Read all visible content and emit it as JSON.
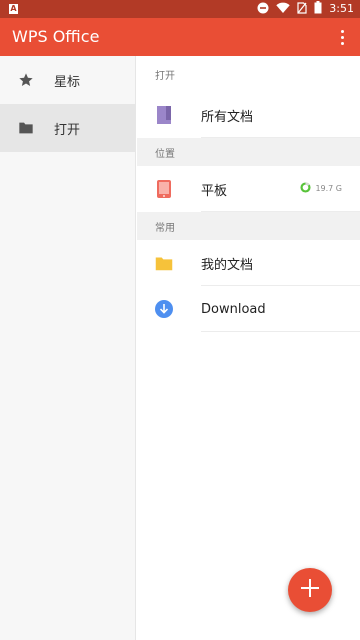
{
  "status_bar": {
    "left_icon_label": "A",
    "time": "3:51",
    "icons": [
      "do-not-disturb-icon",
      "wifi-icon",
      "no-sim-icon",
      "battery-icon"
    ]
  },
  "app_bar": {
    "title": "WPS Office",
    "overflow_icon": "more-vertical-icon"
  },
  "sidebar": {
    "items": [
      {
        "label": "星标",
        "icon": "star-icon",
        "active": false
      },
      {
        "label": "打开",
        "icon": "folder-icon",
        "active": true
      }
    ]
  },
  "main": {
    "sections": [
      {
        "header": "打开",
        "items": [
          {
            "label": "所有文档",
            "icon": "document-icon"
          }
        ]
      },
      {
        "header": "位置",
        "items": [
          {
            "label": "平板",
            "icon": "tablet-icon",
            "storage_text": "19.7 G"
          }
        ]
      },
      {
        "header": "常用",
        "items": [
          {
            "label": "我的文档",
            "icon": "folder-icon"
          },
          {
            "label": "Download",
            "icon": "download-icon"
          }
        ]
      }
    ]
  },
  "fab": {
    "icon": "plus-icon"
  },
  "colors": {
    "status_bar": "#b23a26",
    "accent": "#e94e35",
    "folder": "#f6c23a",
    "document": "#9b86c9",
    "tablet": "#ef6b5e",
    "download": "#4e8ff0",
    "storage_ring": "#58c33a"
  }
}
